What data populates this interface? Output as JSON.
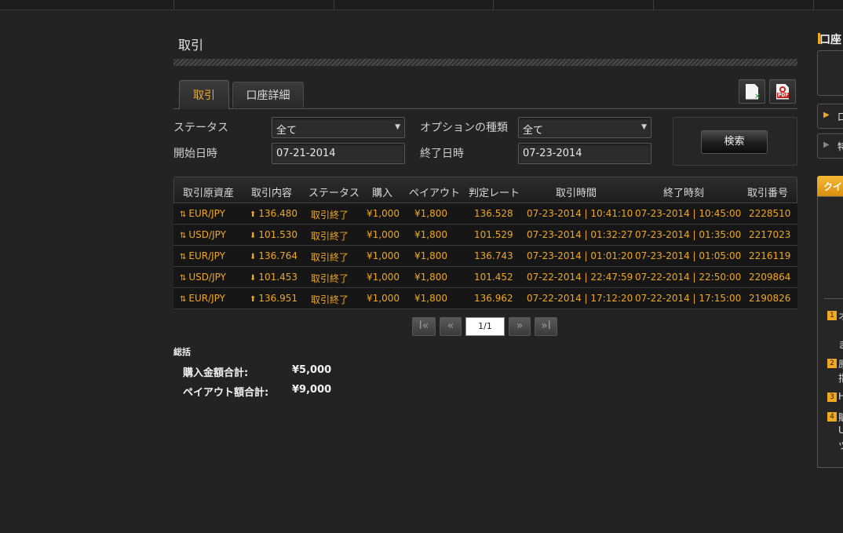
{
  "page_title": "取引",
  "tabs": [
    {
      "label": "取引",
      "active": true
    },
    {
      "label": "口座詳細",
      "active": false
    }
  ],
  "export": {
    "excel_icon": "excel-export-icon",
    "pdf_icon": "pdf-export-icon",
    "pdf_text": "PDF"
  },
  "filters": {
    "status_label": "ステータス",
    "status_value": "全て",
    "option_type_label": "オプションの種類",
    "option_type_value": "全て",
    "start_label": "開始日時",
    "start_value": "07-21-2014",
    "end_label": "終了日時",
    "end_value": "07-23-2014",
    "search_label": "検索"
  },
  "table": {
    "headers": [
      "取引原資産",
      "取引内容",
      "ステータス",
      "購入",
      "ペイアウト",
      "判定レート",
      "取引時間",
      "終了時刻",
      "取引番号"
    ],
    "rows": [
      {
        "asset": "EUR/JPY",
        "dir": "up",
        "rate": "136.480",
        "status": "取引終了",
        "buy": "¥1,000",
        "payout": "¥1,800",
        "judge": "136.528",
        "time": "07-23-2014 | 10:41:10",
        "end": "07-23-2014 | 10:45:00",
        "id": "2228510"
      },
      {
        "asset": "USD/JPY",
        "dir": "down",
        "rate": "101.530",
        "status": "取引終了",
        "buy": "¥1,000",
        "payout": "¥1,800",
        "judge": "101.529",
        "time": "07-23-2014 | 01:32:27",
        "end": "07-23-2014 | 01:35:00",
        "id": "2217023"
      },
      {
        "asset": "EUR/JPY",
        "dir": "down",
        "rate": "136.764",
        "status": "取引終了",
        "buy": "¥1,000",
        "payout": "¥1,800",
        "judge": "136.743",
        "time": "07-23-2014 | 01:01:20",
        "end": "07-23-2014 | 01:05:00",
        "id": "2216119"
      },
      {
        "asset": "USD/JPY",
        "dir": "down",
        "rate": "101.453",
        "status": "取引終了",
        "buy": "¥1,000",
        "payout": "¥1,800",
        "judge": "101.452",
        "time": "07-22-2014 | 22:47:59",
        "end": "07-22-2014 | 22:50:00",
        "id": "2209864"
      },
      {
        "asset": "EUR/JPY",
        "dir": "up",
        "rate": "136.951",
        "status": "取引終了",
        "buy": "¥1,000",
        "payout": "¥1,800",
        "judge": "136.962",
        "time": "07-22-2014 | 17:12:20",
        "end": "07-22-2014 | 17:15:00",
        "id": "2190826"
      }
    ]
  },
  "pagination": {
    "first": "I«",
    "prev": "«",
    "page": "1/1",
    "next": "»",
    "last": "»I"
  },
  "summary": {
    "title": "総括",
    "purchase_label": "購入金額合計:",
    "purchase_value": "¥5,000",
    "payout_label": "ペイアウト額合計:",
    "payout_value": "¥9,000"
  },
  "right_panel": {
    "title": "口座",
    "items": [
      "口",
      "特"
    ],
    "tab": "クイ",
    "notes": [
      {
        "num": "1",
        "lines": [
          "オ",
          "「",
          "ま"
        ]
      },
      {
        "num": "2",
        "lines": [
          "原",
          "指"
        ]
      },
      {
        "num": "3",
        "lines": [
          "H"
        ]
      },
      {
        "num": "4",
        "lines": [
          "購",
          "U",
          "ツ"
        ]
      }
    ]
  },
  "colors": {
    "accent": "#f0a820",
    "background": "#232323",
    "row_bg": "#161616"
  }
}
